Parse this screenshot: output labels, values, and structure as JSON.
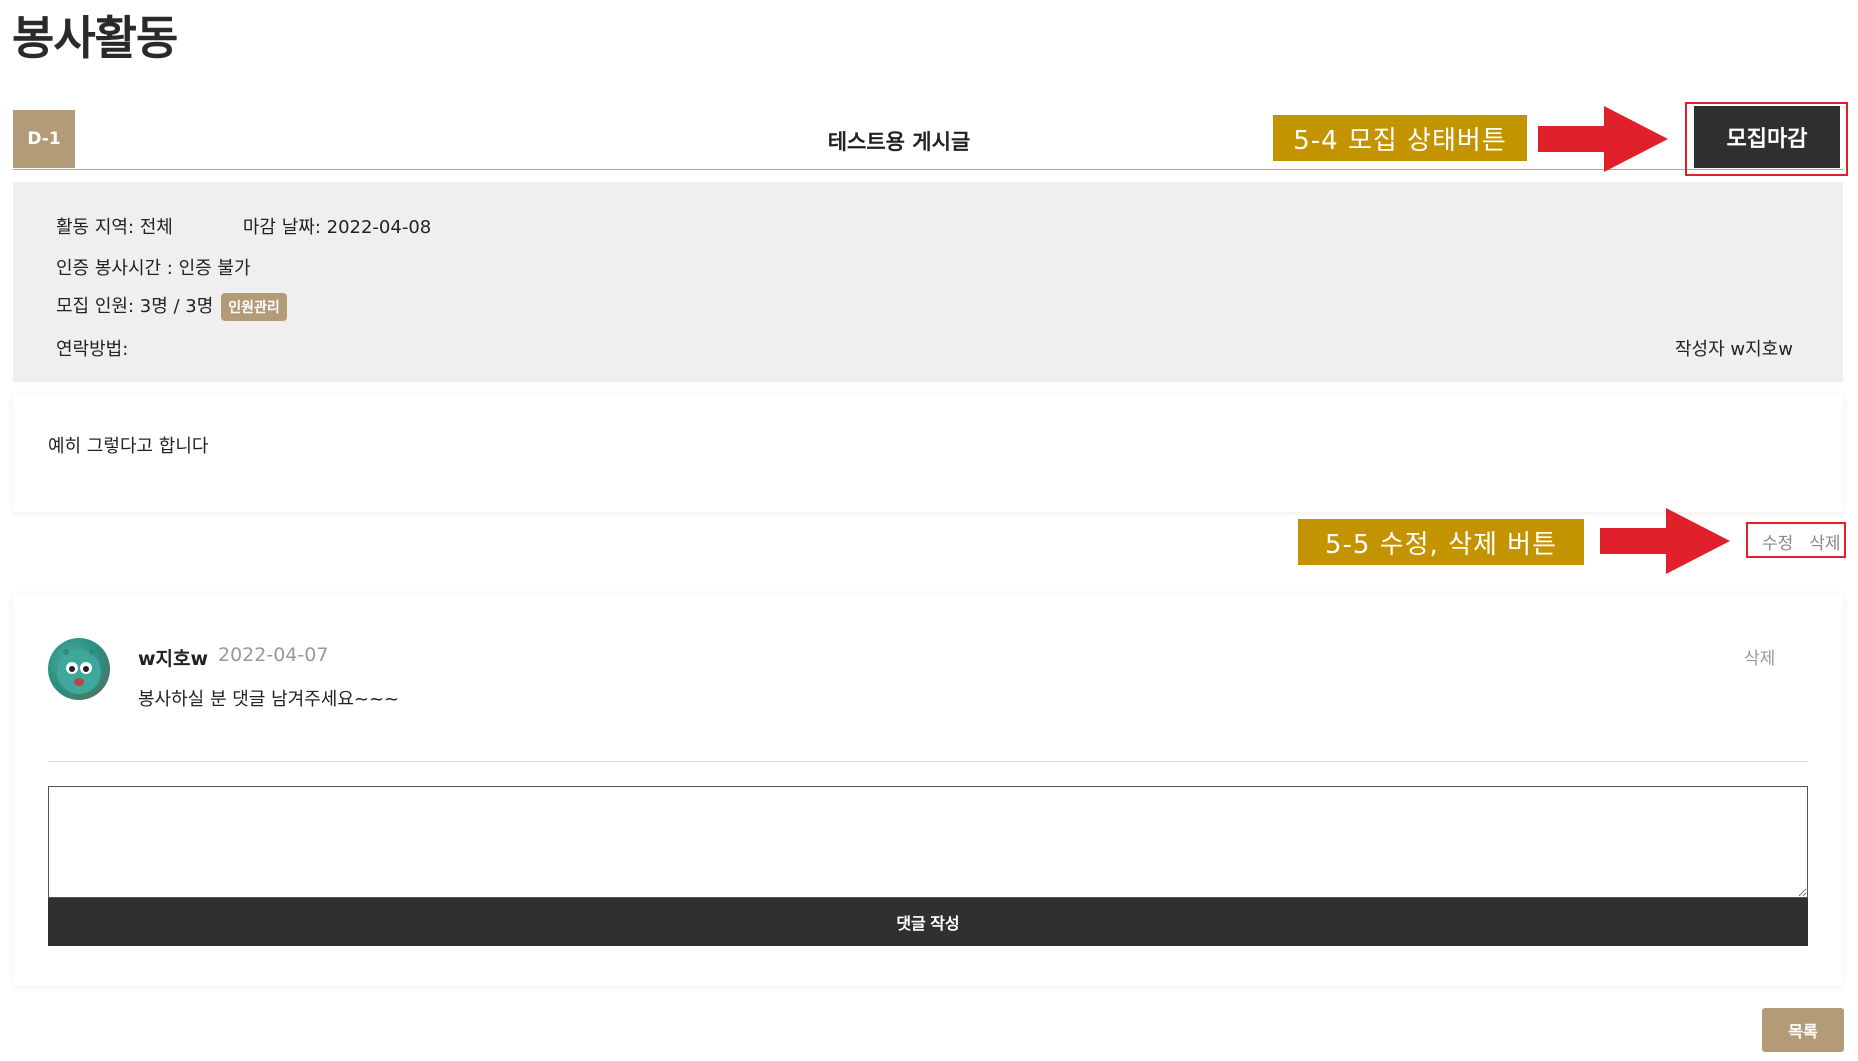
{
  "page": {
    "title": "봉사활동"
  },
  "post": {
    "dday": "D-1",
    "title": "테스트용 게시글",
    "recruit_button": "모집마감",
    "info": {
      "region": "활동 지역: 전체",
      "deadline": "마감 날짜: 2022-04-08",
      "cert_hours": "인증 봉사시간 : 인증 불가",
      "members": "모집 인원: 3명 / 3명",
      "manage_badge": "인원관리",
      "contact": "연락방법:",
      "author": "작성자  w지호w"
    },
    "content": "예히 그렇다고 합니다",
    "edit_label": "수정",
    "delete_label": "삭제"
  },
  "annotations": {
    "recruit": "5-4 모집 상태버튼",
    "edit_delete": "5-5 수정, 삭제 버튼"
  },
  "comments": [
    {
      "author": "w지호w",
      "date": "2022-04-07",
      "text": "봉사하실 분 댓글 남겨주세요~~~",
      "delete_label": "삭제"
    }
  ],
  "comment_form": {
    "submit_label": "댓글 작성"
  },
  "footer": {
    "list_button": "목록"
  },
  "colors": {
    "accent": "#b49b78",
    "dark": "#2f2f2f",
    "annotation": "#c49400",
    "arrow": "#e0202a"
  }
}
